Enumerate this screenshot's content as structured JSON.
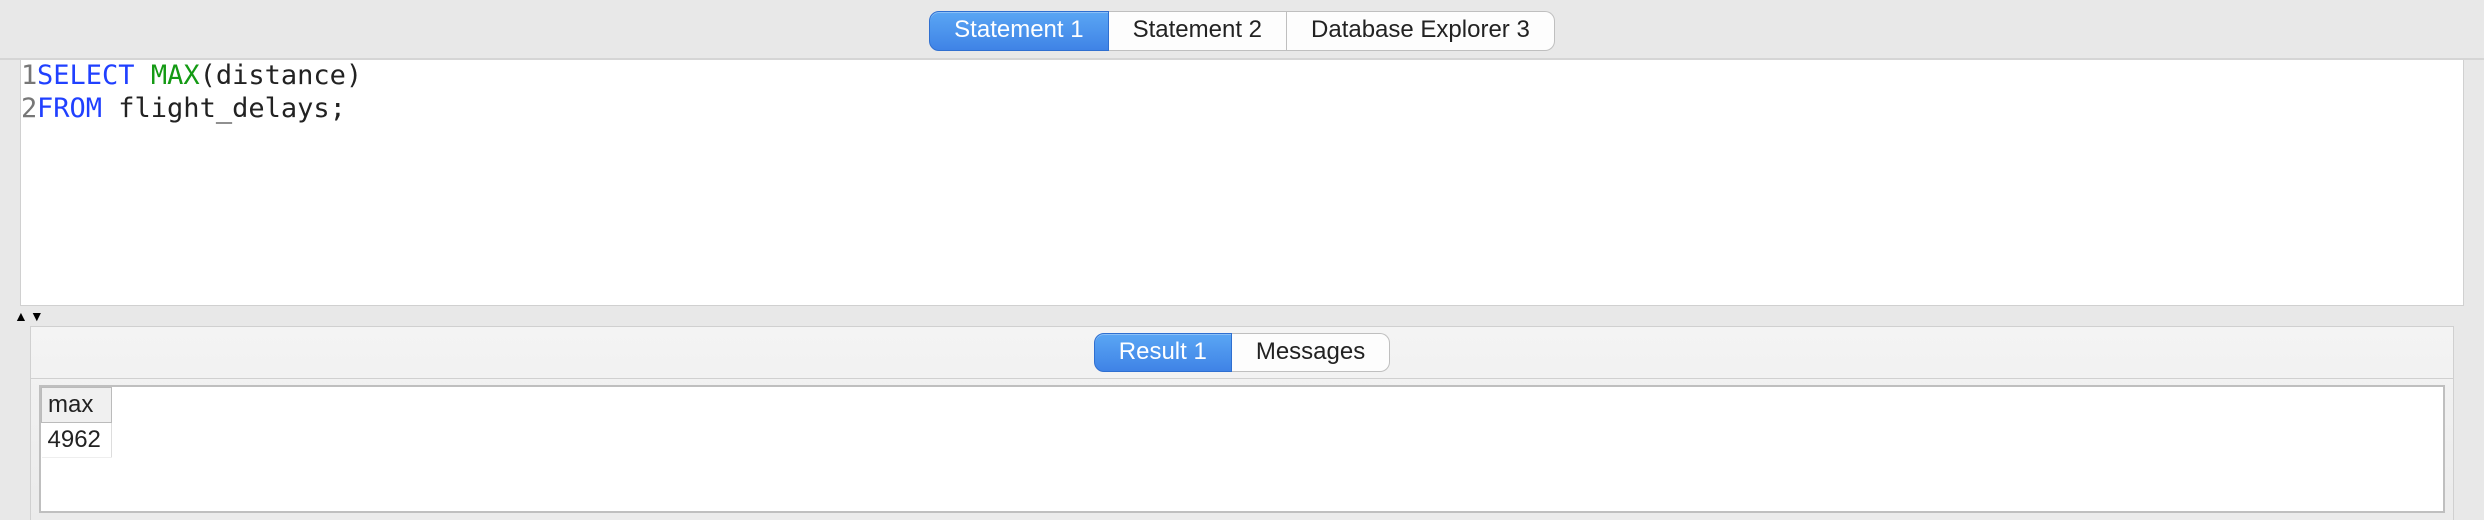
{
  "top_tabs": {
    "items": [
      {
        "label": "Statement 1",
        "active": true
      },
      {
        "label": "Statement 2",
        "active": false
      },
      {
        "label": "Database Explorer 3",
        "active": false
      }
    ]
  },
  "editor": {
    "lines": [
      {
        "n": "1",
        "tokens": [
          "SELECT",
          " ",
          "MAX",
          "(distance)"
        ]
      },
      {
        "n": "2",
        "tokens": [
          "FROM",
          " flight_delays;"
        ]
      }
    ],
    "line1": {
      "n": "1",
      "select": "SELECT",
      "sp": " ",
      "max": "MAX",
      "rest": "(distance)"
    },
    "line2": {
      "n": "2",
      "from": "FROM",
      "rest": " flight_delays;"
    }
  },
  "split": {
    "up": "▲",
    "down": "▼"
  },
  "results_tabs": {
    "items": [
      {
        "label": "Result 1",
        "active": true
      },
      {
        "label": "Messages",
        "active": false
      }
    ]
  },
  "result": {
    "columns": [
      "max"
    ],
    "rows": [
      [
        "4962"
      ]
    ]
  }
}
